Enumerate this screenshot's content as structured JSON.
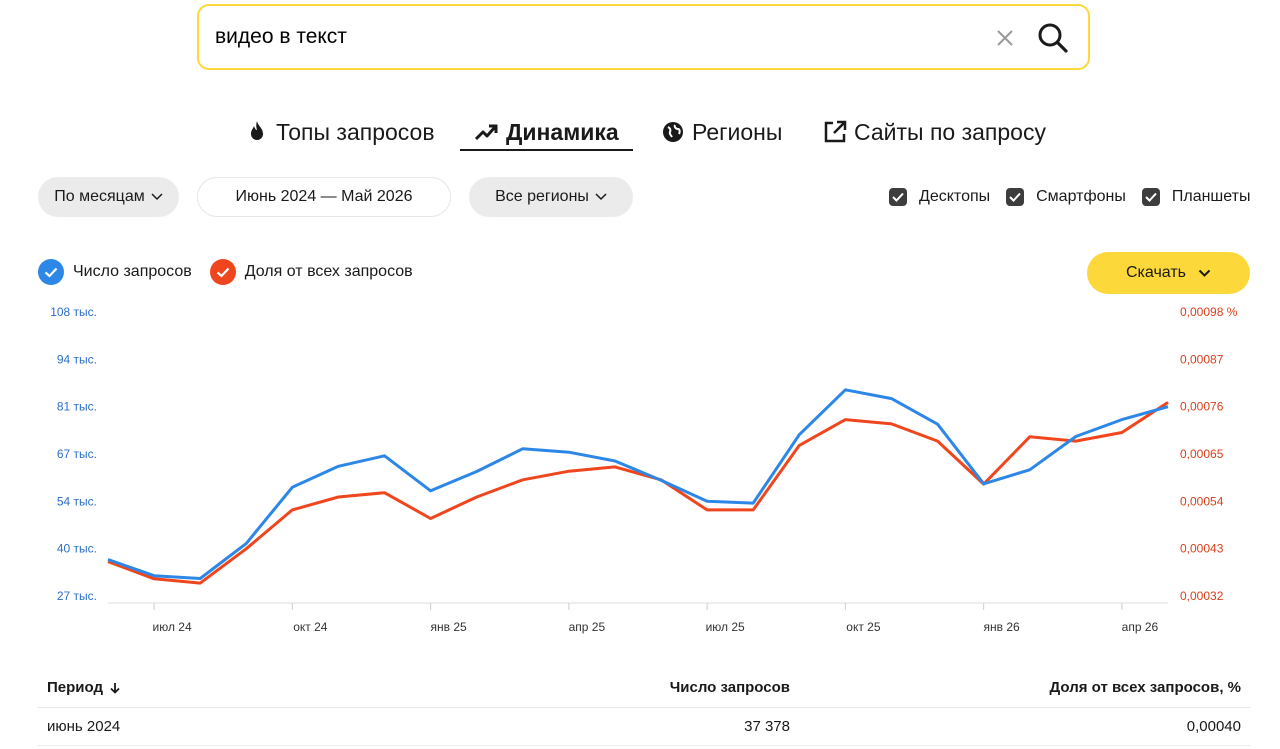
{
  "search": {
    "value": "видео в текст",
    "placeholder": ""
  },
  "tabs": [
    {
      "label": "Топы запросов",
      "icon": "fire-icon"
    },
    {
      "label": "Динамика",
      "icon": "trend-icon"
    },
    {
      "label": "Регионы",
      "icon": "globe-icon"
    },
    {
      "label": "Сайты по запросу",
      "icon": "external-link-icon"
    }
  ],
  "filters": {
    "period_mode": "По месяцам",
    "date_range": "Июнь 2024 — Май 2026",
    "regions": "Все регионы",
    "devices": [
      {
        "label": "Десктопы",
        "checked": true
      },
      {
        "label": "Смартфоны",
        "checked": true
      },
      {
        "label": "Планшеты",
        "checked": true
      }
    ]
  },
  "legend": {
    "queries": "Число запросов",
    "share": "Доля от всех запросов"
  },
  "download_label": "Скачать",
  "colors": {
    "accent": "#fdd83a",
    "queries": "#2d87e6",
    "share": "#f0461e"
  },
  "chart_data": {
    "type": "line",
    "x": [
      "июн 2024",
      "июл 2024",
      "авг 2024",
      "сен 2024",
      "окт 2024",
      "ноя 2024",
      "дек 2024",
      "янв 2025",
      "фев 2025",
      "мар 2025",
      "апр 2025",
      "май 2025",
      "июн 2025",
      "июл 2025",
      "авг 2025",
      "сен 2025",
      "окт 2025",
      "ноя 2025",
      "дек 2025",
      "янв 2026",
      "фев 2026",
      "мар 2026",
      "апр 2026",
      "май 2026"
    ],
    "x_tick_labels": [
      "июл 24",
      "окт 24",
      "янв 25",
      "апр 25",
      "июл 25",
      "окт 25",
      "янв 26",
      "апр 26"
    ],
    "x_tick_positions": [
      1,
      4,
      7,
      10,
      13,
      16,
      19,
      22
    ],
    "y_left_ticks": [
      "108 тыс.",
      "94 тыс.",
      "81 тыс.",
      "67 тыс.",
      "54 тыс.",
      "40 тыс.",
      "27 тыс."
    ],
    "y_right_ticks": [
      "0,00098 %",
      "0,00087",
      "0,00076",
      "0,00065",
      "0,00054",
      "0,00043",
      "0,00032"
    ],
    "ylim_left": [
      27000,
      108000
    ],
    "ylim_right": [
      0.00032,
      0.00098
    ],
    "series": [
      {
        "name": "Число запросов",
        "axis": "left",
        "values": [
          37378,
          32800,
          32000,
          42000,
          58000,
          64000,
          67000,
          57000,
          62500,
          69000,
          68000,
          65500,
          60000,
          54000,
          53500,
          73000,
          85800,
          83300,
          76000,
          59000,
          63000,
          72500,
          77300,
          81000
        ]
      },
      {
        "name": "Доля от всех запросов",
        "axis": "right",
        "values": [
          0.0004,
          0.00036,
          0.00035,
          0.00043,
          0.00052,
          0.00055,
          0.00056,
          0.0005,
          0.00055,
          0.00059,
          0.00061,
          0.00062,
          0.00059,
          0.00052,
          0.00052,
          0.00067,
          0.00073,
          0.00072,
          0.00068,
          0.00058,
          0.00069,
          0.00068,
          0.0007,
          0.00077
        ]
      }
    ]
  },
  "table": {
    "headers": {
      "period": "Период",
      "queries": "Число запросов",
      "share": "Доля от всех запросов, %"
    },
    "rows": [
      {
        "period": "июнь 2024",
        "queries": "37 378",
        "share": "0,00040"
      }
    ]
  }
}
